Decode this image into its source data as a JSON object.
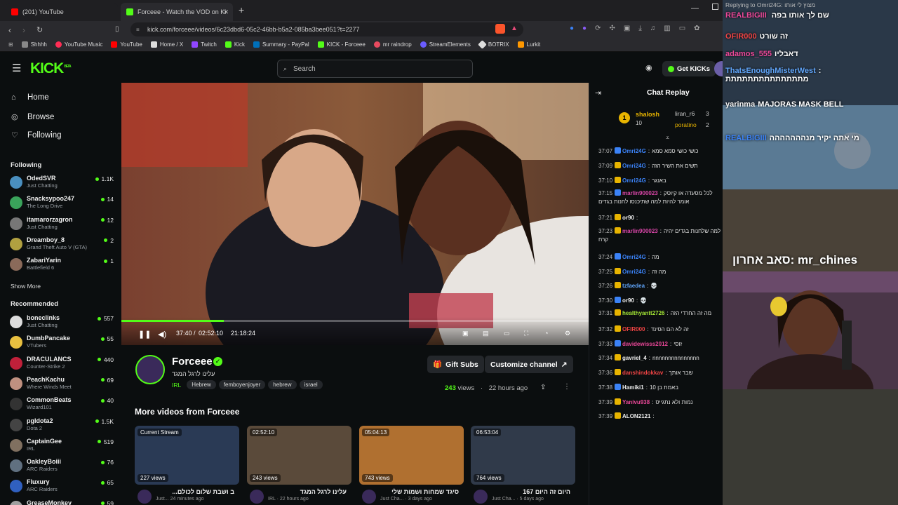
{
  "browser": {
    "tabs": [
      {
        "label": "(201) YouTube",
        "color": "#ff0000"
      },
      {
        "label": "Forceee - Watch the VOD on Ki",
        "color": "#53fc18"
      }
    ],
    "url": "kick.com/forceee/videos/6c23dbd6-05c2-46bb-b5a2-085ba3bee051?t=2277",
    "bookmarks": [
      {
        "label": "Shhhh",
        "color": "#888888"
      },
      {
        "label": "YouTube Music",
        "color": "#ff2d55"
      },
      {
        "label": "YouTube",
        "color": "#ff0000"
      },
      {
        "label": "Home / X",
        "color": "#dddddd"
      },
      {
        "label": "Twitch",
        "color": "#9146ff"
      },
      {
        "label": "Kick",
        "color": "#53fc18"
      },
      {
        "label": "Summary - PayPal",
        "color": "#0070ba"
      },
      {
        "label": "KICK - Forceee",
        "color": "#53fc18"
      },
      {
        "label": "mr raindrop",
        "color": "#e84a5f"
      },
      {
        "label": "StreamElements",
        "color": "#6a5cff"
      },
      {
        "label": "BOTRIX",
        "color": "#dddddd"
      },
      {
        "label": "Lurkit",
        "color": "#ff9800"
      }
    ]
  },
  "header": {
    "logo": "KICK",
    "logo_sup": "BETA",
    "search_placeholder": "Search",
    "get_kicks": "Get KICKs"
  },
  "sidebar": {
    "nav": [
      {
        "label": "Home",
        "icon": "home-icon"
      },
      {
        "label": "Browse",
        "icon": "compass-icon"
      },
      {
        "label": "Following",
        "icon": "heart-icon"
      }
    ],
    "following_title": "Following",
    "following": [
      {
        "name": "OdedSVR",
        "category": "Just Chatting",
        "viewers": "1.1K",
        "color": "#4a8fbf"
      },
      {
        "name": "Snacksypoo247",
        "category": "The Long Drive",
        "viewers": "14",
        "color": "#3aa35b"
      },
      {
        "name": "itamarorzagron",
        "category": "Just Chatting",
        "viewers": "12",
        "color": "#777777"
      },
      {
        "name": "Dreamboy_8",
        "category": "Grand Theft Auto V (GTA)",
        "viewers": "2",
        "color": "#b0a040"
      },
      {
        "name": "ZabariYarin",
        "category": "Battlefield 6",
        "viewers": "1",
        "color": "#8a6a5a"
      }
    ],
    "show_more": "Show More",
    "recommended_title": "Recommended",
    "recommended": [
      {
        "name": "boneclinks",
        "category": "Just Chatting",
        "viewers": "557",
        "color": "#dddddd"
      },
      {
        "name": "DumbPancake",
        "category": "VTubers",
        "viewers": "55",
        "color": "#e8c040"
      },
      {
        "name": "DRACULANCS",
        "category": "Counter-Strike 2",
        "viewers": "440",
        "color": "#c0203a"
      },
      {
        "name": "PeachKachu",
        "category": "Where Winds Meet",
        "viewers": "69",
        "color": "#c09080"
      },
      {
        "name": "CommonBeats",
        "category": "Wizard101",
        "viewers": "40",
        "color": "#333333"
      },
      {
        "name": "pgldota2",
        "category": "Dota 2",
        "viewers": "1.5K",
        "color": "#444444"
      },
      {
        "name": "CaptainGee",
        "category": "IRL",
        "viewers": "519",
        "color": "#807060"
      },
      {
        "name": "OakleyBoiii",
        "category": "ARC Raiders",
        "viewers": "76",
        "color": "#607080"
      },
      {
        "name": "Fluxury",
        "category": "ARC Raiders",
        "viewers": "65",
        "color": "#3060c0"
      },
      {
        "name": "GreaseMonkey",
        "category": "",
        "viewers": "59",
        "color": "#a0a0a0"
      }
    ]
  },
  "player": {
    "progress": 0.219,
    "current_time": "37:40",
    "duration": "02:52:10",
    "timestamp": "21:18:24"
  },
  "stream": {
    "channel": "Forceee",
    "title": "עלינו לרגל המגד",
    "category": "IRL",
    "tags": [
      "Hebrew",
      "femboyenjoyer",
      "hebrew",
      "israel"
    ],
    "gift_subs": "Gift Subs",
    "customize": "Customize channel",
    "views": "243",
    "views_suffix": "views",
    "age": "22 hours ago"
  },
  "more_videos": {
    "title": "More videos from Forceee",
    "items": [
      {
        "badge": "Current Stream",
        "views": "227 views",
        "title": "...ב ושבת שלום לכולם",
        "sub": "Just... 24 minutes ago",
        "color": "#2a3a55"
      },
      {
        "badge": "02:52:10",
        "views": "243 views",
        "title": "עלינו לרגל המגד",
        "sub": "IRL · 22 hours ago",
        "color": "#5a4a3a"
      },
      {
        "badge": "05:04:13",
        "views": "743 views",
        "title": "סיגד שמחות ושמות שלי",
        "sub": "Just Cha... · 3 days ago",
        "color": "#b07030"
      },
      {
        "badge": "06:53:04",
        "views": "764 views",
        "title": "167 היום זה היום",
        "sub": "Just Cha... · 5 days ago",
        "color": "#303a4a"
      }
    ]
  },
  "chat": {
    "title": "Chat Replay",
    "leaderboard": [
      {
        "name": "shalosh",
        "count": "10"
      },
      {
        "name": "liran_r6",
        "count": "3"
      },
      {
        "name": "poratino",
        "count": "2"
      }
    ],
    "messages": [
      {
        "time": "37:07",
        "user": "Omri24G",
        "color": "#3b82f6",
        "text": "כושי כושי סמא סמא"
      },
      {
        "time": "37:09",
        "user": "Omri24G",
        "color": "#3b82f6",
        "text": "תשים את השיר הזה"
      },
      {
        "time": "37:10",
        "user": "Omri24G",
        "color": "#3b82f6",
        "text": "באנגר"
      },
      {
        "time": "37:15",
        "user": "marlin900023",
        "color": "#d946a8",
        "text": "לכל מסעדה או קיוסק אומר להיות למה שתיכנסו לחנות בגדים"
      },
      {
        "time": "37:21",
        "user": "or90",
        "color": "#f0f0f0",
        "text": ""
      },
      {
        "time": "37:23",
        "user": "marlin900023",
        "color": "#d946a8",
        "text": "למה שלחנות בגדים יהיה קרח"
      },
      {
        "time": "37:24",
        "user": "Omri24G",
        "color": "#3b82f6",
        "text": "מה"
      },
      {
        "time": "37:25",
        "user": "Omri24G",
        "color": "#3b82f6",
        "text": "מה זה"
      },
      {
        "time": "37:26",
        "user": "tzfaedea",
        "color": "#60a5fa",
        "text": "💀"
      },
      {
        "time": "37:30",
        "user": "or90",
        "color": "#f0f0f0",
        "text": "💀"
      },
      {
        "time": "37:31",
        "user": "healthyantt2726",
        "color": "#a3e635",
        "text": "מה זה החרדי הזה"
      },
      {
        "time": "37:32",
        "user": "OFIR000",
        "color": "#ef4444",
        "text": "זה לא הם הסינד"
      },
      {
        "time": "37:33",
        "user": "davidewisss2012",
        "color": "#ec4899",
        "text": "זוסי"
      },
      {
        "time": "37:34",
        "user": "gavriel_4",
        "color": "#f0f0f0",
        "text": "nnnnnnnnnnnnnnn"
      },
      {
        "time": "37:36",
        "user": "danshindokkav",
        "color": "#ef4444",
        "text": "שבר אותך"
      },
      {
        "time": "37:38",
        "user": "Hamiki1",
        "color": "#f0f0f0",
        "text": "באמת בן 10"
      },
      {
        "time": "37:39",
        "user": "Yanivu938",
        "color": "#ec4899",
        "text": "נמות ולא נתגייס"
      },
      {
        "time": "37:39",
        "user": "ALON2121",
        "color": "#f0f0f0",
        "text": ""
      }
    ]
  },
  "overlay": {
    "reply_hint": "Replying to Omri24G: מצוץ לי אותו",
    "top_line_user": "REALBIGIII",
    "top_line_text": "שם לך אותו בפה",
    "messages": [
      {
        "user": "OFIR000",
        "color": "#ef4444",
        "text": "זה שורט"
      },
      {
        "user": "adamos_555",
        "color": "#ec4899",
        "text": "דאבליו"
      },
      {
        "user": "ThatsEnoughMisterWest",
        "color": "#60a5fa",
        "text": ": מתתתתתתתתתתתתתת"
      },
      {
        "user": "yarinma",
        "color": "#f0f0f0",
        "text": "MAJORAS MASK BELL"
      },
      {
        "user": "REALBIGIII",
        "color": "#3b82f6",
        "text": "מי אתה יקיר מנההההההה"
      }
    ],
    "cam_label": "סאב אחרון: mr_chines"
  }
}
